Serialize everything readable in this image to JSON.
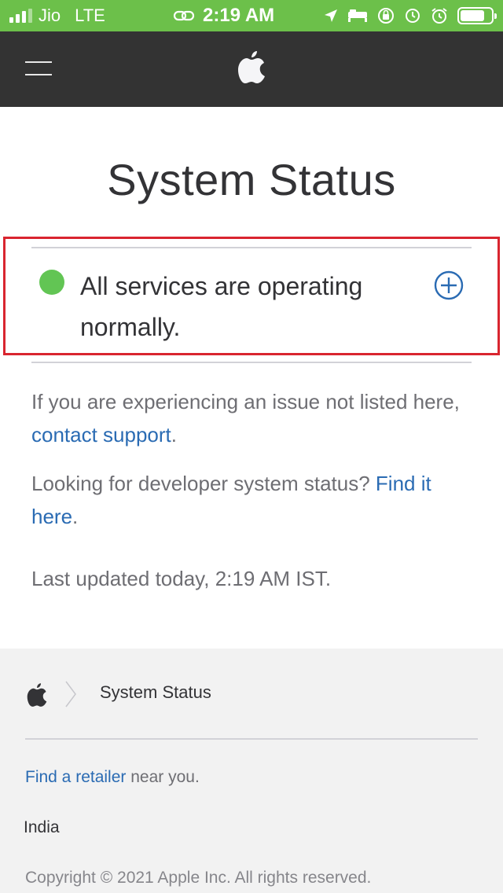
{
  "status_bar": {
    "carrier": "Jio",
    "network": "LTE",
    "time": "2:19 AM",
    "icons": [
      "signal-icon",
      "link-icon",
      "location-icon",
      "bed-icon",
      "orientation-lock-icon",
      "alarm-icon",
      "battery-icon"
    ],
    "battery_percent": 80
  },
  "nav": {
    "menu_icon": "hamburger-icon",
    "logo_icon": "apple-logo-icon"
  },
  "main": {
    "title": "System Status",
    "status": {
      "message": "All services are operating normally.",
      "indicator_color": "#62c554",
      "expand_icon": "plus-circle-icon"
    },
    "support_text_before": "If you are experiencing an issue not listed here, ",
    "support_link": "contact support",
    "support_text_after": ".",
    "developer_text_before": "Looking for developer system status? ",
    "developer_link": "Find it here",
    "developer_text_after": ".",
    "last_updated": "Last updated today, 2:19 AM IST."
  },
  "footer": {
    "breadcrumb_current": "System Status",
    "retailer_link": "Find a retailer",
    "retailer_suffix": " near you.",
    "country": "India",
    "copyright": "Copyright © 2021 Apple Inc. All rights reserved."
  },
  "colors": {
    "status_bar_bg": "#6cc04a",
    "nav_bg": "#333333",
    "link": "#2a6bb3",
    "highlight_border": "#d9252f",
    "footer_bg": "#f2f2f2"
  }
}
